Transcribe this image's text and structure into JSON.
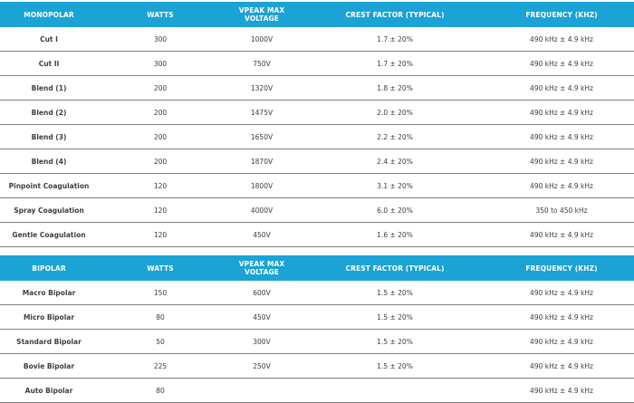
{
  "monopolar": {
    "headers": [
      "MONOPOLAR",
      "WATTS",
      "VPEAK MAX VOLTAGE",
      "CREST FACTOR (TYPICAL)",
      "FREQUENCY (KHZ)"
    ],
    "rows": [
      [
        "Cut I",
        "300",
        "1000V",
        "1.7 ± 20%",
        "490 kHz ± 4.9 kHz"
      ],
      [
        "Cut II",
        "300",
        "750V",
        "1.7 ± 20%",
        "490 kHz ± 4.9 kHz"
      ],
      [
        "Blend (1)",
        "200",
        "1320V",
        "1.8 ± 20%",
        "490 kHz ± 4.9 kHz"
      ],
      [
        "Blend (2)",
        "200",
        "1475V",
        "2.0 ± 20%",
        "490 kHz ± 4.9 kHz"
      ],
      [
        "Blend (3)",
        "200",
        "1650V",
        "2.2 ± 20%",
        "490 kHz ± 4.9 kHz"
      ],
      [
        "Blend (4)",
        "200",
        "1870V",
        "2.4 ± 20%",
        "490 kHz ± 4.9 kHz"
      ],
      [
        "Pinpoint Coagulation",
        "120",
        "1800V",
        "3.1 ± 20%",
        "490 kHz ± 4.9 kHz"
      ],
      [
        "Spray Coagulation",
        "120",
        "4000V",
        "6.0 ± 20%",
        "350 to 450 kHz"
      ],
      [
        "Gentle Coagulation",
        "120",
        "450V",
        "1.6 ± 20%",
        "490 kHz ± 4.9 kHz"
      ]
    ]
  },
  "bipolar": {
    "headers": [
      "BIPOLAR",
      "WATTS",
      "VPEAK MAX VOLTAGE",
      "CREST FACTOR (TYPICAL)",
      "FREQUENCY (KHZ)"
    ],
    "rows": [
      [
        "Macro Bipolar",
        "150",
        "600V",
        "1.5 ± 20%",
        "490 kHz ± 4.9 kHz"
      ],
      [
        "Micro Bipolar",
        "80",
        "450V",
        "1.5 ± 20%",
        "490 kHz ± 4.9 kHz"
      ],
      [
        "Standard Bipolar",
        "50",
        "300V",
        "1.5 ± 20%",
        "490 kHz ± 4.9 kHz"
      ],
      [
        "Bovie Bipolar",
        "225",
        "250V",
        "1.5 ± 20%",
        "490 kHz ± 4.9 kHz"
      ],
      [
        "Auto Bipolar",
        "80",
        "",
        "",
        "490 kHz ± 4.9 kHz"
      ]
    ]
  },
  "colors": {
    "header_bg": "#1aa3d4",
    "header_text": "#ffffff",
    "row_border": "#7f7f7f"
  }
}
